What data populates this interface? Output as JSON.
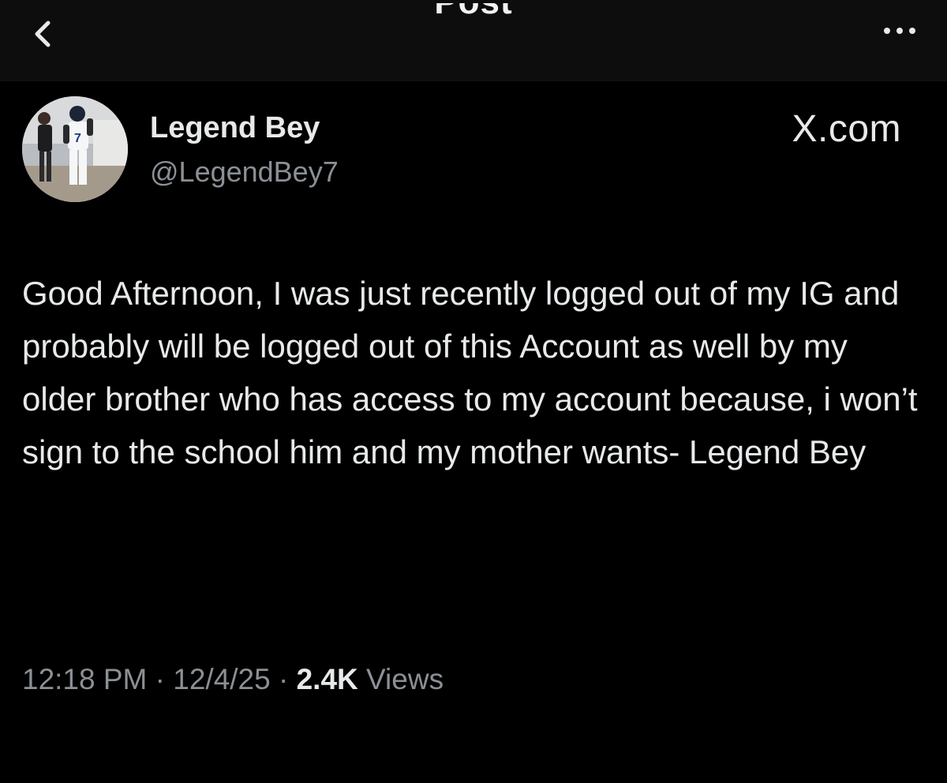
{
  "header": {
    "title": "Post",
    "back_icon": "back-arrow-icon",
    "more_icon": "more-horizontal-icon"
  },
  "author": {
    "name": "Legend Bey",
    "handle": "@LegendBey7",
    "avatar_icon": "profile-photo"
  },
  "source": "X.com",
  "tweet": {
    "text": "Good Afternoon, I was just recently logged out of my IG and probably will be logged out of this Account as well by my older brother who has access to my account because, i won’t sign to the school him and my mother wants- Legend Bey"
  },
  "meta": {
    "time": "12:18 PM",
    "sep1": " · ",
    "date": "12/4/25",
    "sep2": " · ",
    "views_count": "2.4K",
    "views_label": " Views"
  },
  "colors": {
    "background": "#000000",
    "primary_text": "#e7e9ea",
    "secondary_text": "#8b9095"
  }
}
